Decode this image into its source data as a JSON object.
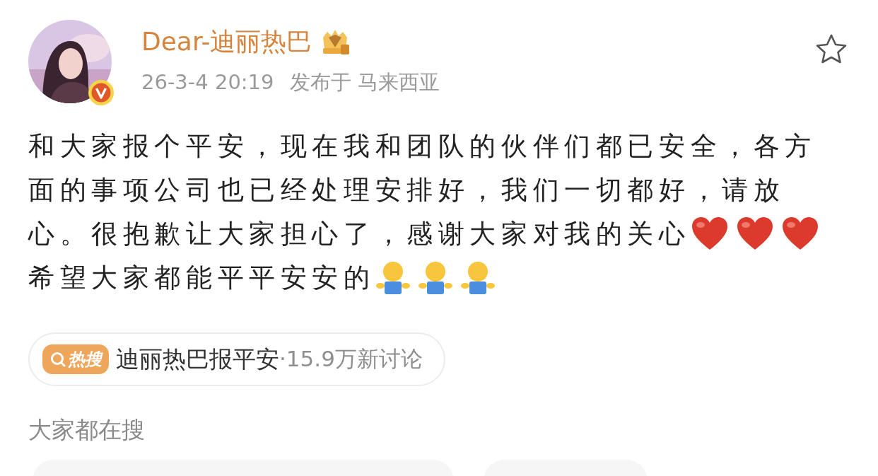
{
  "author": {
    "name": "Dear-迪丽热巴",
    "verified": true,
    "time": "26-3-4 20:19",
    "location": "发布于 马来西亚"
  },
  "favorite": {
    "on": false
  },
  "paragraphs": [
    {
      "lines": [
        "和大家报个平安，现在我和团队的伙伴们都已安全，各方",
        "面的事项公司也已经处理安排好，我们一切都好，请放",
        "心。很抱歉让大家担心了，感谢大家对我的关心"
      ],
      "emojis": [
        {
          "kind": "heart"
        },
        {
          "kind": "heart"
        },
        {
          "kind": "heart"
        }
      ]
    },
    {
      "lines": [
        "希望大家都能平平安安的"
      ],
      "emojis": [
        {
          "kind": "hug"
        },
        {
          "kind": "hug"
        },
        {
          "kind": "hug"
        }
      ]
    }
  ],
  "hot_topic": {
    "badge": "热搜",
    "topic": "迪丽热巴报平安",
    "count": "·15.9万新讨论"
  },
  "related": {
    "title": "大家都在搜",
    "cards": [
      {
        "kind": "wide"
      },
      {
        "kind": "narrow"
      }
    ]
  }
}
